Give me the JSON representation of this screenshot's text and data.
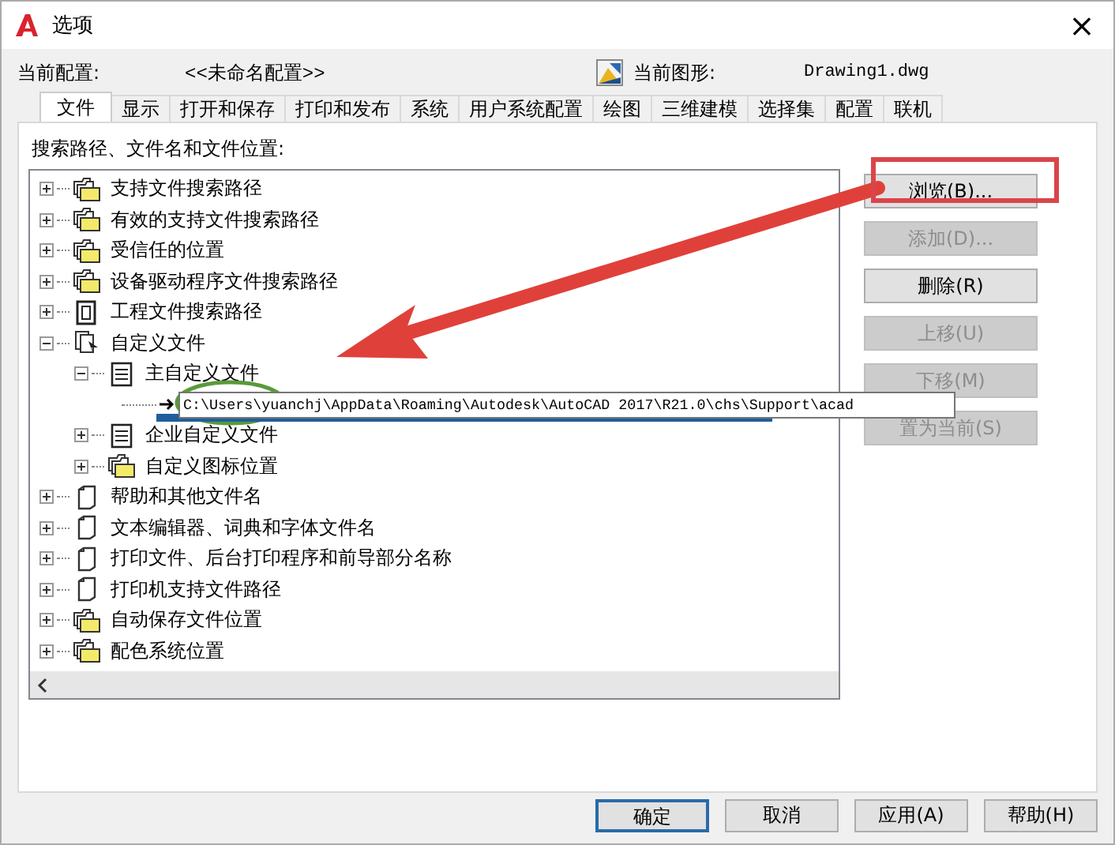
{
  "window": {
    "title": "选项",
    "close": "×"
  },
  "profile": {
    "label": "当前配置:",
    "value": "<<未命名配置>>"
  },
  "drawing": {
    "label": "当前图形:",
    "value": "Drawing1.dwg"
  },
  "tabs": [
    {
      "label": "文件",
      "selected": true
    },
    {
      "label": "显示",
      "selected": false
    },
    {
      "label": "打开和保存",
      "selected": false
    },
    {
      "label": "打印和发布",
      "selected": false
    },
    {
      "label": "系统",
      "selected": false
    },
    {
      "label": "用户系统配置",
      "selected": false
    },
    {
      "label": "绘图",
      "selected": false
    },
    {
      "label": "三维建模",
      "selected": false
    },
    {
      "label": "选择集",
      "selected": false
    },
    {
      "label": "配置",
      "selected": false
    },
    {
      "label": "联机",
      "selected": false
    }
  ],
  "tree_label": "搜索路径、文件名和文件位置:",
  "tree": [
    {
      "label": "支持文件搜索路径",
      "kind": "folder",
      "expanded": false
    },
    {
      "label": "有效的支持文件搜索路径",
      "kind": "folder",
      "expanded": false
    },
    {
      "label": "受信任的位置",
      "kind": "folder",
      "expanded": false
    },
    {
      "label": "设备驱动程序文件搜索路径",
      "kind": "folder",
      "expanded": false
    },
    {
      "label": "工程文件搜索路径",
      "kind": "project",
      "expanded": false
    },
    {
      "label": "自定义文件",
      "kind": "files",
      "expanded": true,
      "children": [
        {
          "label": "主自定义文件",
          "kind": "cui",
          "expanded": true,
          "children": [
            {
              "label": "C:\\Users\\yuanchj\\AppData\\Roaming\\Autodesk\\AutoCAD 2017\\R21.0\\chs\\Support\\acad",
              "kind": "path",
              "selected": true
            }
          ]
        },
        {
          "label": "企业自定义文件",
          "kind": "cui",
          "expanded": false
        },
        {
          "label": "自定义图标位置",
          "kind": "folder",
          "expanded": false
        }
      ]
    },
    {
      "label": "帮助和其他文件名",
      "kind": "file",
      "expanded": false
    },
    {
      "label": "文本编辑器、词典和字体文件名",
      "kind": "file",
      "expanded": false
    },
    {
      "label": "打印文件、后台打印程序和前导部分名称",
      "kind": "file",
      "expanded": false
    },
    {
      "label": "打印机支持文件路径",
      "kind": "file",
      "expanded": false
    },
    {
      "label": "自动保存文件位置",
      "kind": "folder",
      "expanded": false
    },
    {
      "label": "配色系统位置",
      "kind": "folder",
      "expanded": false
    }
  ],
  "side_buttons": [
    {
      "label": "浏览(B)...",
      "disabled": false
    },
    {
      "label": "添加(D)...",
      "disabled": true
    },
    {
      "label": "删除(R)",
      "disabled": false
    },
    {
      "label": "上移(U)",
      "disabled": true
    },
    {
      "label": "下移(M)",
      "disabled": true
    },
    {
      "label": "置为当前(S)",
      "disabled": true
    }
  ],
  "footer_buttons": [
    {
      "label": "确定",
      "default": true
    },
    {
      "label": "取消",
      "default": false
    },
    {
      "label": "应用(A)",
      "default": false
    },
    {
      "label": "帮助(H)",
      "default": false
    }
  ]
}
